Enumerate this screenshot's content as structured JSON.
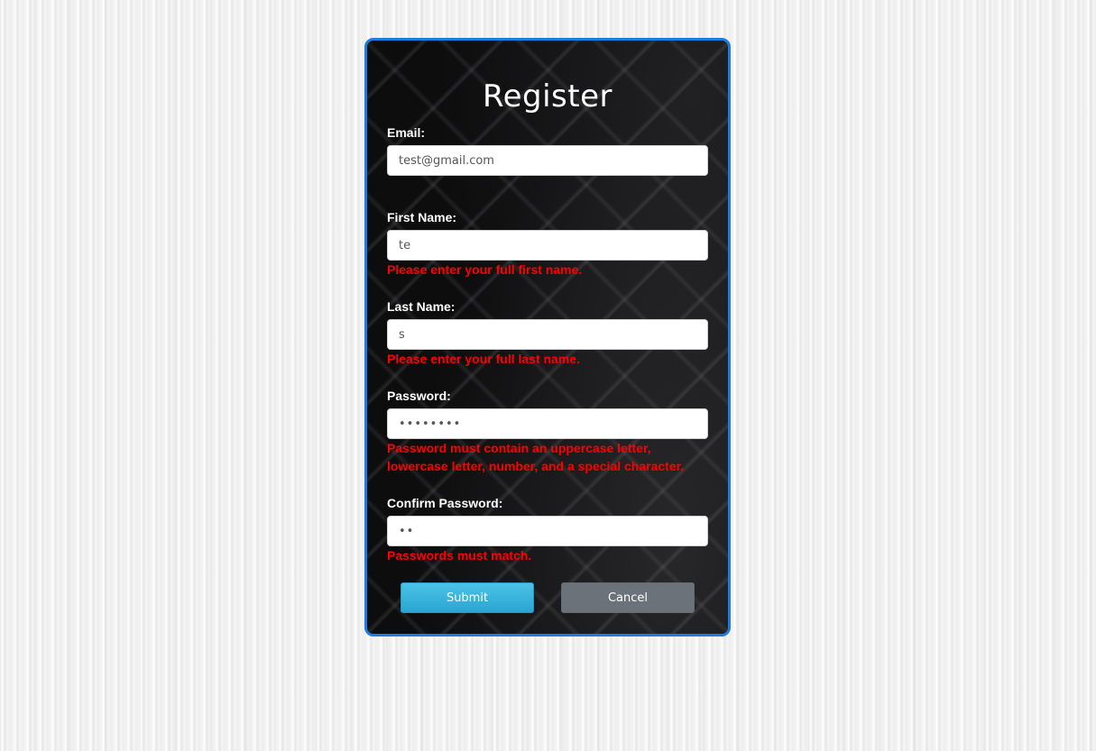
{
  "form": {
    "title": "Register",
    "email": {
      "label": "Email:",
      "value": "test@gmail.com"
    },
    "first_name": {
      "label": "First Name:",
      "value": "te",
      "error": "Please enter your full first name."
    },
    "last_name": {
      "label": "Last Name:",
      "value": "s",
      "error": "Please enter your full last name."
    },
    "password": {
      "label": "Password:",
      "value": "••••••••",
      "error": "Password must contain an uppercase letter, lowercase letter, number, and a special character."
    },
    "confirm_password": {
      "label": "Confirm Password:",
      "value": "••",
      "error": "Passwords must match."
    },
    "submit_label": "Submit",
    "cancel_label": "Cancel"
  },
  "colors": {
    "card_border": "#1e7be0",
    "error_text": "#ff0000",
    "submit_bg": "#2aa5d3",
    "cancel_bg": "#6c727a"
  }
}
